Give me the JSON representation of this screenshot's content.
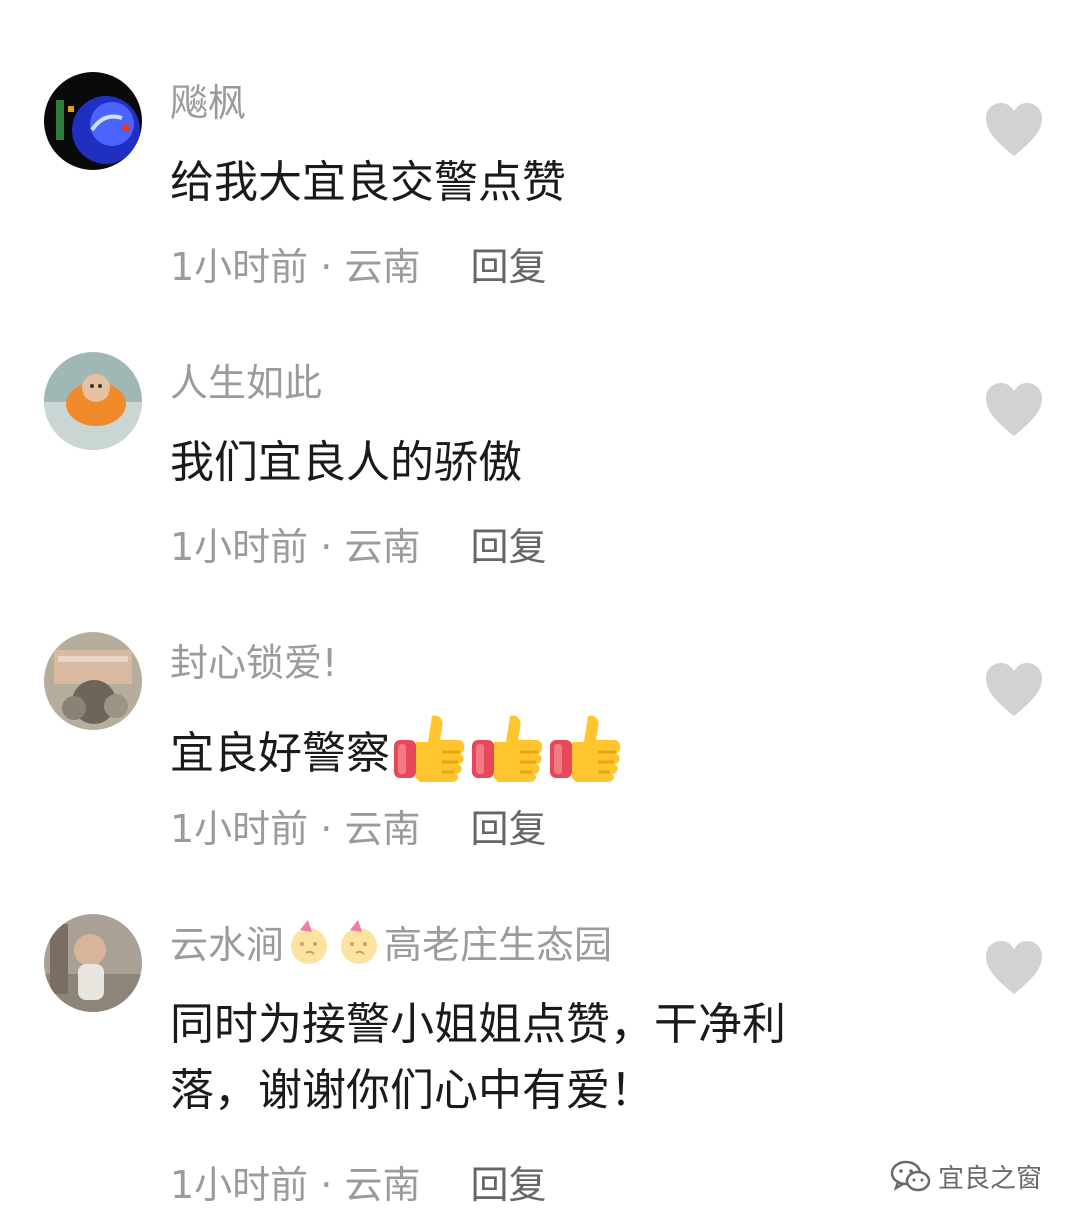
{
  "comments": [
    {
      "username": "飚枫",
      "content": "给我大宜良交警点赞",
      "time": "1小时前",
      "separator": " · ",
      "location": "云南",
      "reply_label": "回复"
    },
    {
      "username": "人生如此",
      "content": "我们宜良人的骄傲",
      "time": "1小时前",
      "separator": " · ",
      "location": "云南",
      "reply_label": "回复"
    },
    {
      "username": "封心锁爱!",
      "content": "宜良好警察",
      "content_emojis": [
        "thumbs-up",
        "thumbs-up",
        "thumbs-up"
      ],
      "time": "1小时前",
      "separator": " · ",
      "location": "云南",
      "reply_label": "回复"
    },
    {
      "username_prefix": "云水涧",
      "username_emojis": [
        "party-face",
        "party-face"
      ],
      "username_suffix": "高老庄生态园",
      "content_line1": "同时为接警小姐姐点赞，干净利",
      "content_line2": "落，谢谢你们心中有爱！",
      "time": "1小时前",
      "separator": " · ",
      "location": "云南",
      "reply_label": "回复"
    }
  ],
  "like_icon": "heart-icon",
  "colors": {
    "username": "#9b9b9b",
    "content": "#1a1a1a",
    "meta": "#9b9b9b",
    "heart": "#d2d2d2"
  },
  "watermark": {
    "icon": "wechat-icon",
    "text": "宜良之窗"
  }
}
